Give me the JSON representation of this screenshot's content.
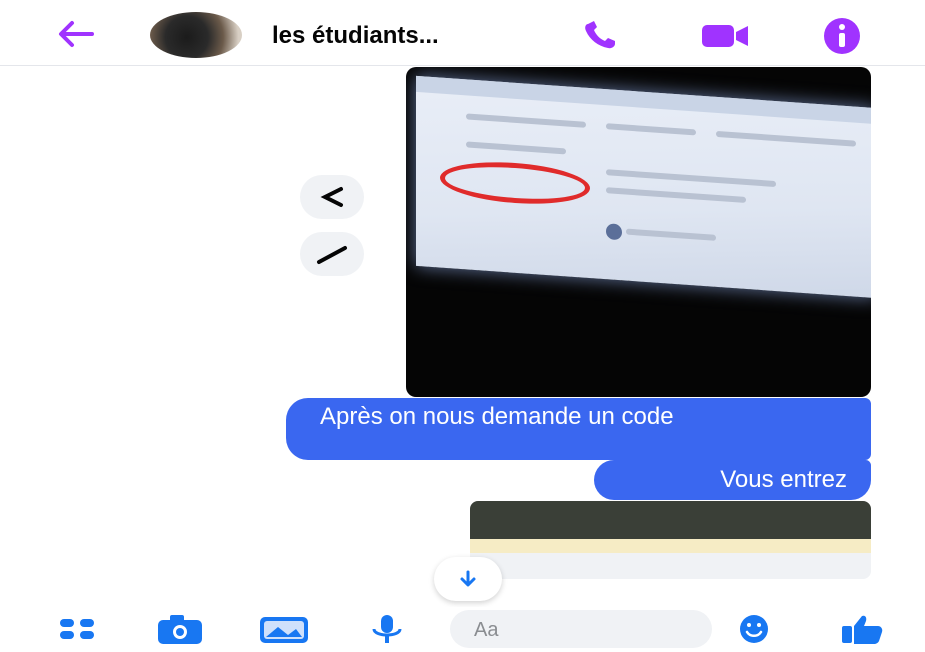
{
  "header": {
    "title": "les étudiants...",
    "icons": [
      "back-arrow-icon",
      "phone-icon",
      "video-camera-icon",
      "info-icon"
    ]
  },
  "messages": [
    {
      "type": "image",
      "description_icon": "photo-message"
    },
    {
      "type": "text",
      "text": "Après on nous demande un code"
    },
    {
      "type": "text",
      "text": "Vous entrez"
    },
    {
      "type": "image-preview"
    }
  ],
  "composer": {
    "placeholder": "Aa",
    "icons": [
      "apps-grid-icon",
      "camera-icon",
      "gallery-icon",
      "microphone-icon",
      "emoji-icon",
      "thumbs-up-icon"
    ]
  },
  "colors": {
    "accent": "#a033ff",
    "bubble": "#3a67f0",
    "background": "#ffffff"
  }
}
